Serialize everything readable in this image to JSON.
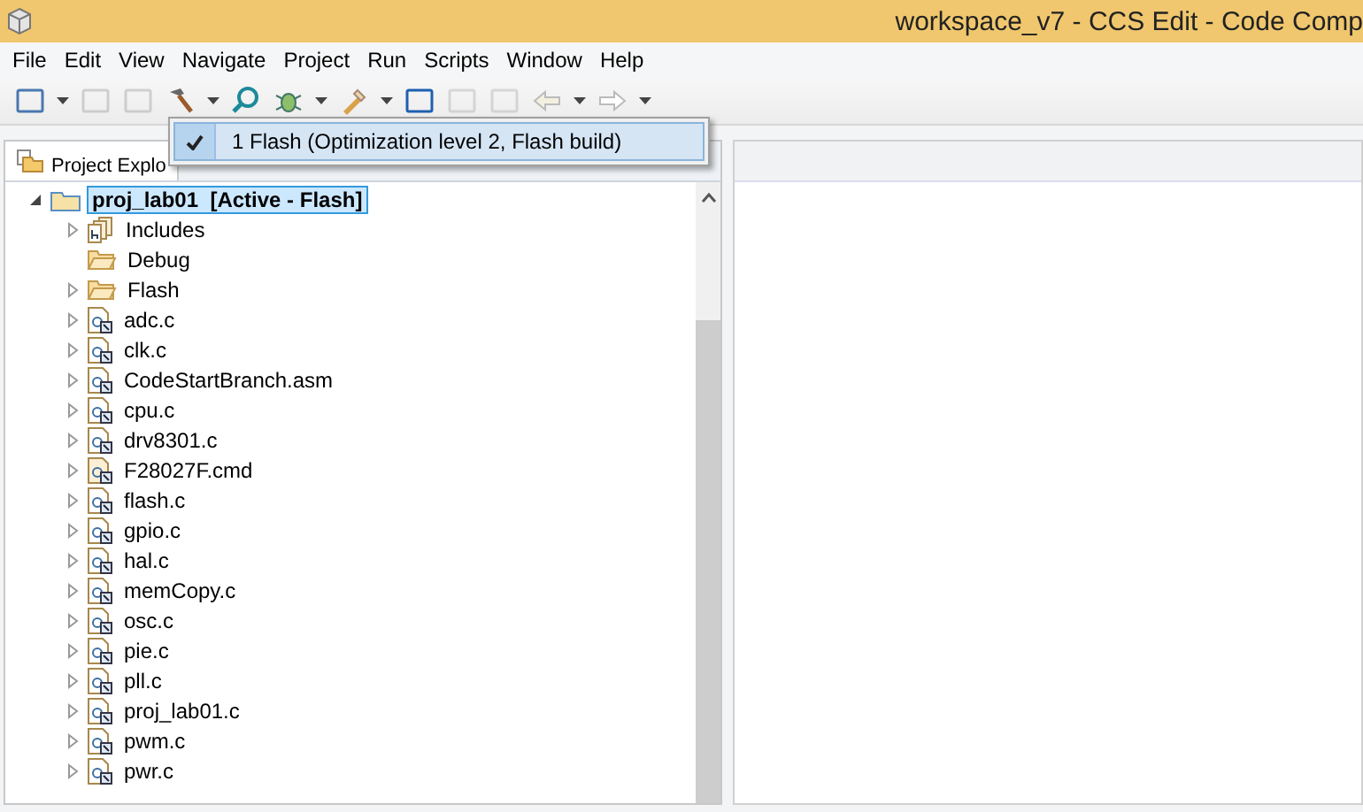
{
  "window": {
    "title": "workspace_v7 - CCS Edit - Code Comp"
  },
  "menu": [
    "File",
    "Edit",
    "View",
    "Navigate",
    "Project",
    "Run",
    "Scripts",
    "Window",
    "Help"
  ],
  "build_menu": {
    "items": [
      {
        "label": "1 Flash (Optimization level 2, Flash build)",
        "checked": true
      }
    ]
  },
  "project_explorer": {
    "tab": "Project Explo",
    "tree": [
      {
        "name": "proj_lab01",
        "suffix": "[Active - Flash]",
        "kind": "project",
        "expanded": true,
        "selected": true,
        "children": [
          {
            "name": "Includes",
            "kind": "includes",
            "expanded": false
          },
          {
            "name": "Debug",
            "kind": "folder"
          },
          {
            "name": "Flash",
            "kind": "folder",
            "expanded": false
          },
          {
            "name": "adc.c",
            "kind": "source",
            "expanded": false
          },
          {
            "name": "clk.c",
            "kind": "source",
            "expanded": false
          },
          {
            "name": "CodeStartBranch.asm",
            "kind": "asm",
            "expanded": false
          },
          {
            "name": "cpu.c",
            "kind": "source",
            "expanded": false
          },
          {
            "name": "drv8301.c",
            "kind": "source",
            "expanded": false
          },
          {
            "name": "F28027F.cmd",
            "kind": "cmd",
            "expanded": false
          },
          {
            "name": "flash.c",
            "kind": "source",
            "expanded": false
          },
          {
            "name": "gpio.c",
            "kind": "source",
            "expanded": false
          },
          {
            "name": "hal.c",
            "kind": "source",
            "expanded": false
          },
          {
            "name": "memCopy.c",
            "kind": "source",
            "expanded": false
          },
          {
            "name": "osc.c",
            "kind": "source",
            "expanded": false
          },
          {
            "name": "pie.c",
            "kind": "source",
            "expanded": false
          },
          {
            "name": "pll.c",
            "kind": "source",
            "expanded": false
          },
          {
            "name": "proj_lab01.c",
            "kind": "source",
            "expanded": false
          },
          {
            "name": "pwm.c",
            "kind": "source",
            "expanded": false
          },
          {
            "name": "pwr.c",
            "kind": "source",
            "expanded": false
          }
        ]
      }
    ]
  }
}
